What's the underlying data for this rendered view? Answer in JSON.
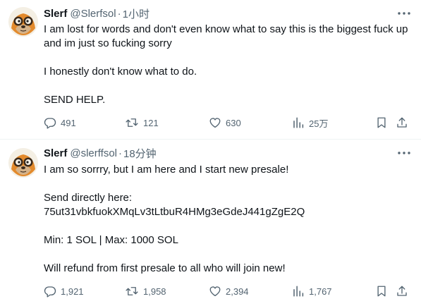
{
  "colors": {
    "text": "#0f1419",
    "secondary": "#536471",
    "divider": "#eff3f4"
  },
  "tweets": [
    {
      "name": "Slerf",
      "handle": "@Slerfsol",
      "dot": "·",
      "time": "1小时",
      "paragraphs": [
        "I am lost for words and don't even know what to say this is the biggest fuck up and im just so fucking sorry",
        "I honestly don't know what to do.",
        "SEND HELP."
      ],
      "replies": "491",
      "retweets": "121",
      "likes": "630",
      "views": "25万"
    },
    {
      "name": "Slerf",
      "handle": "@slerffsol",
      "dot": "·",
      "time": "18分钟",
      "paragraphs": [
        "I am so sorrry, but I am here and I start new presale!",
        "Send directly here:\n75ut31vbkfuokXMqLv3tLtbuR4HMg3eGdeJ441gZgE2Q",
        "Min: 1 SOL | Max: 1000 SOL",
        "Will refund from first presale to all who will join new!"
      ],
      "replies": "1,921",
      "retweets": "1,958",
      "likes": "2,394",
      "views": "1,767"
    }
  ],
  "icons": {
    "avatar": "sloth-avatar",
    "more": "more-icon",
    "reply": "reply-icon",
    "retweet": "retweet-icon",
    "like": "heart-icon",
    "views": "views-icon",
    "bookmark": "bookmark-icon",
    "share": "share-icon"
  }
}
